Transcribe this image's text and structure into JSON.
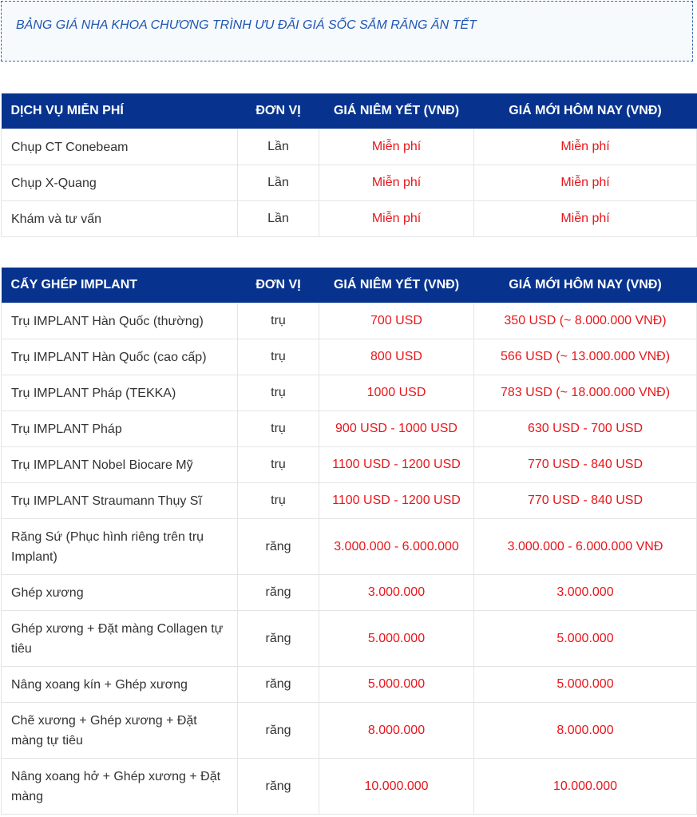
{
  "banner": {
    "text": "BẢNG GIÁ NHA KHOA CHƯƠNG TRÌNH ƯU ĐÃI GIÁ SỐC SẮM RĂNG ĂN TẾT"
  },
  "colors": {
    "header_bg": "#07338f",
    "price_text": "#e8161b",
    "banner_text": "#1f55b0"
  },
  "free_table": {
    "headers": [
      "DỊCH VỤ MIỄN PHÍ",
      "ĐƠN VỊ",
      "GIÁ NIÊM YẾT (VNĐ)",
      "GIÁ MỚI HÔM NAY (VNĐ)"
    ],
    "rows": [
      {
        "service": "Chụp CT Conebeam",
        "unit": "Lần",
        "list_price": "Miễn phí",
        "new_price": "Miễn phí"
      },
      {
        "service": "Chụp X-Quang",
        "unit": "Lần",
        "list_price": "Miễn phí",
        "new_price": "Miễn phí"
      },
      {
        "service": "Khám và tư vấn",
        "unit": "Lần",
        "list_price": "Miễn phí",
        "new_price": "Miễn phí"
      }
    ]
  },
  "implant_table": {
    "headers": [
      "CẤY GHÉP IMPLANT",
      "ĐƠN VỊ",
      "GIÁ NIÊM YẾT (VNĐ)",
      "GIÁ MỚI HÔM NAY (VNĐ)"
    ],
    "rows": [
      {
        "service": "Trụ IMPLANT Hàn Quốc (thường)",
        "unit": "trụ",
        "list_price": "700 USD",
        "new_price": "350 USD (~ 8.000.000 VNĐ)"
      },
      {
        "service": "Trụ IMPLANT Hàn Quốc (cao cấp)",
        "unit": "trụ",
        "list_price": "800 USD",
        "new_price": "566 USD (~ 13.000.000 VNĐ)"
      },
      {
        "service": "Trụ IMPLANT Pháp (TEKKA)",
        "unit": "trụ",
        "list_price": "1000 USD",
        "new_price": "783 USD (~ 18.000.000 VNĐ)"
      },
      {
        "service": "Trụ IMPLANT Pháp",
        "unit": "trụ",
        "list_price": "900 USD - 1000 USD",
        "new_price": "630 USD - 700 USD"
      },
      {
        "service": "Trụ IMPLANT Nobel Biocare Mỹ",
        "unit": "trụ",
        "list_price": "1100 USD - 1200 USD",
        "new_price": "770 USD - 840 USD"
      },
      {
        "service": "Trụ IMPLANT Straumann Thụy Sĩ",
        "unit": "trụ",
        "list_price": "1100 USD - 1200 USD",
        "new_price": "770 USD - 840 USD"
      },
      {
        "service": "Răng Sứ (Phục hình riêng trên trụ Implant)",
        "unit": "răng",
        "list_price": "3.000.000 - 6.000.000",
        "new_price": "3.000.000 - 6.000.000 VNĐ"
      },
      {
        "service": "Ghép xương",
        "unit": "răng",
        "list_price": "3.000.000",
        "new_price": "3.000.000"
      },
      {
        "service": "Ghép xương + Đặt màng Collagen tự tiêu",
        "unit": "răng",
        "list_price": "5.000.000",
        "new_price": "5.000.000"
      },
      {
        "service": "Nâng xoang kín + Ghép xương",
        "unit": "răng",
        "list_price": "5.000.000",
        "new_price": "5.000.000"
      },
      {
        "service": "Chẽ xương + Ghép xương + Đặt màng tự tiêu",
        "unit": "răng",
        "list_price": "8.000.000",
        "new_price": "8.000.000"
      },
      {
        "service": "Nâng xoang hở + Ghép xương + Đặt màng",
        "unit": "răng",
        "list_price": "10.000.000",
        "new_price": "10.000.000"
      }
    ]
  }
}
